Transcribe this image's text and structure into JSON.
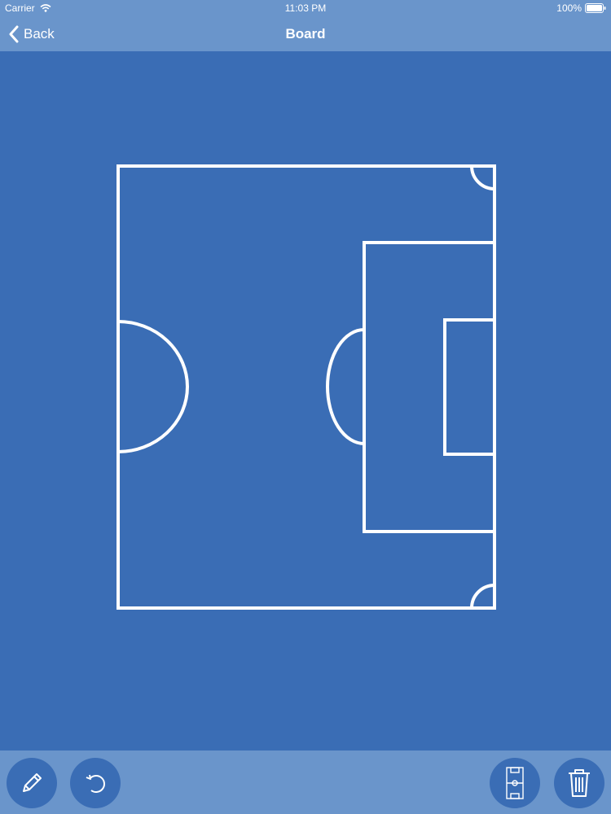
{
  "status_bar": {
    "carrier": "Carrier",
    "time": "11:03 PM",
    "battery": "100%"
  },
  "nav": {
    "back_label": "Back",
    "title": "Board"
  },
  "toolbar": {
    "items": [
      "pencil-icon",
      "undo-icon",
      "pitch-icon",
      "trash-icon"
    ]
  },
  "colors": {
    "background": "#3a6db5",
    "bars": "#6a95cb",
    "lines": "#ffffff"
  }
}
